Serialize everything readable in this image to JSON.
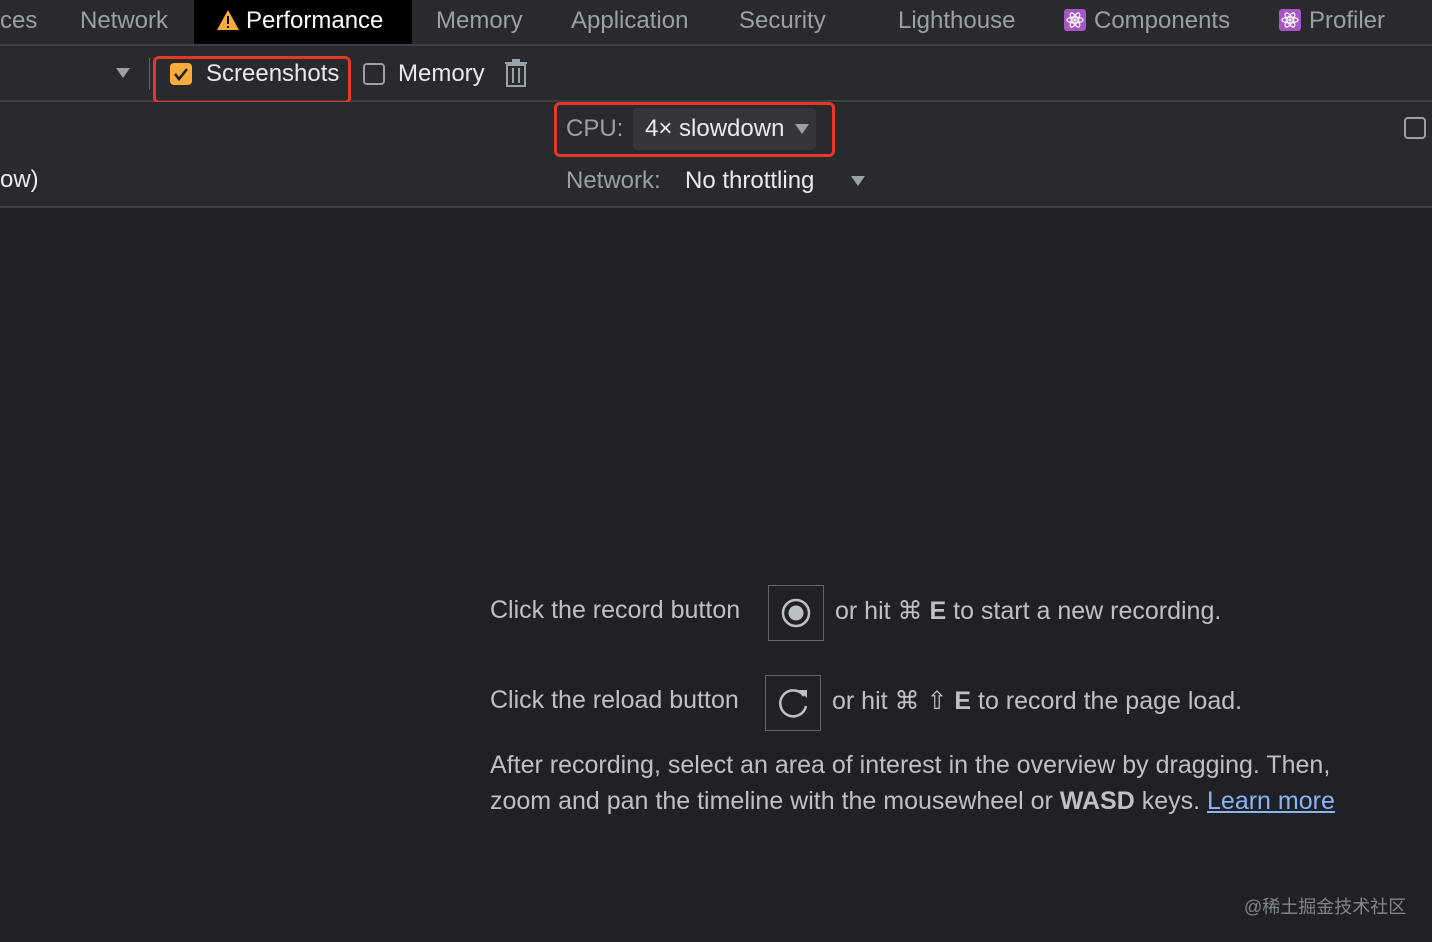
{
  "tabs": [
    {
      "label": "ces",
      "active": false
    },
    {
      "label": "Network",
      "active": false
    },
    {
      "label": "Performance",
      "active": true,
      "icon": "warning-icon"
    },
    {
      "label": "Memory",
      "active": false
    },
    {
      "label": "Application",
      "active": false
    },
    {
      "label": "Security",
      "active": false
    },
    {
      "label": "Lighthouse",
      "active": false
    },
    {
      "label": "Components",
      "active": false,
      "icon": "react-icon"
    },
    {
      "label": "Profiler",
      "active": false,
      "icon": "react-icon"
    }
  ],
  "toolbar": {
    "screenshots_label": "Screenshots",
    "screenshots_checked": true,
    "memory_label": "Memory",
    "memory_checked": false,
    "trash_icon": "trash-icon"
  },
  "throttling": {
    "cpu_label": "CPU:",
    "cpu_value": "4× slowdown",
    "network_label": "Network:",
    "network_value": "No throttling",
    "left_fragment": "ow)"
  },
  "landing": {
    "record_prefix": "Click the record button",
    "record_suffix_pre": "or hit ⌘ ",
    "record_key": "E",
    "record_suffix_post": " to start a new recording.",
    "reload_prefix": "Click the reload button",
    "reload_suffix_pre": "or hit ⌘ ⇧ ",
    "reload_key": "E",
    "reload_suffix_post": " to record the page load.",
    "info_line1": "After recording, select an area of interest in the overview by dragging. Then,",
    "info_line2_pre": "zoom and pan the timeline with the mousewheel or ",
    "info_line2_bold": "WASD",
    "info_line2_post": " keys. ",
    "learn_more": "Learn more"
  },
  "watermark": "@稀土掘金技术社区",
  "colors": {
    "accent_checkbox": "#f9ab3b",
    "highlight_red": "#e5382b",
    "link": "#8ab4f8"
  }
}
